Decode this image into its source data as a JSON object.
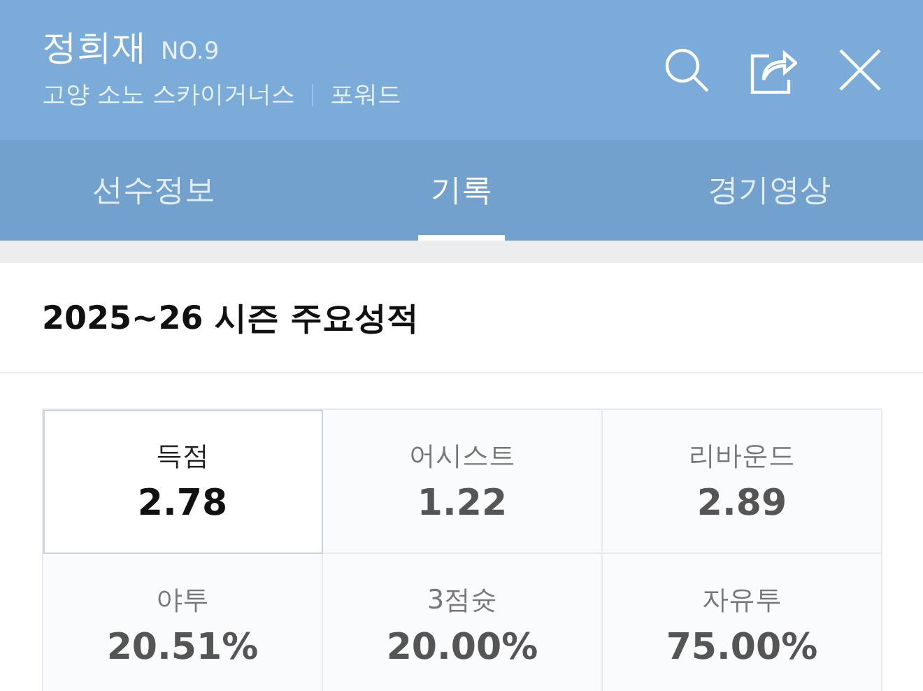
{
  "header": {
    "name": "정희재",
    "number": "NO.9",
    "team": "고양 소노 스카이거너스",
    "position": "포워드"
  },
  "tabs": [
    {
      "label": "선수정보",
      "selected": false
    },
    {
      "label": "기록",
      "selected": true
    },
    {
      "label": "경기영상",
      "selected": false
    }
  ],
  "section": {
    "title": "2025~26 시즌 주요성적"
  },
  "stats": [
    {
      "label": "득점",
      "value": "2.78",
      "selected": true
    },
    {
      "label": "어시스트",
      "value": "1.22",
      "selected": false
    },
    {
      "label": "리바운드",
      "value": "2.89",
      "selected": false
    },
    {
      "label": "야투",
      "value": "20.51%",
      "selected": false
    },
    {
      "label": "3점슛",
      "value": "20.00%",
      "selected": false
    },
    {
      "label": "자유투",
      "value": "75.00%",
      "selected": false
    }
  ]
}
